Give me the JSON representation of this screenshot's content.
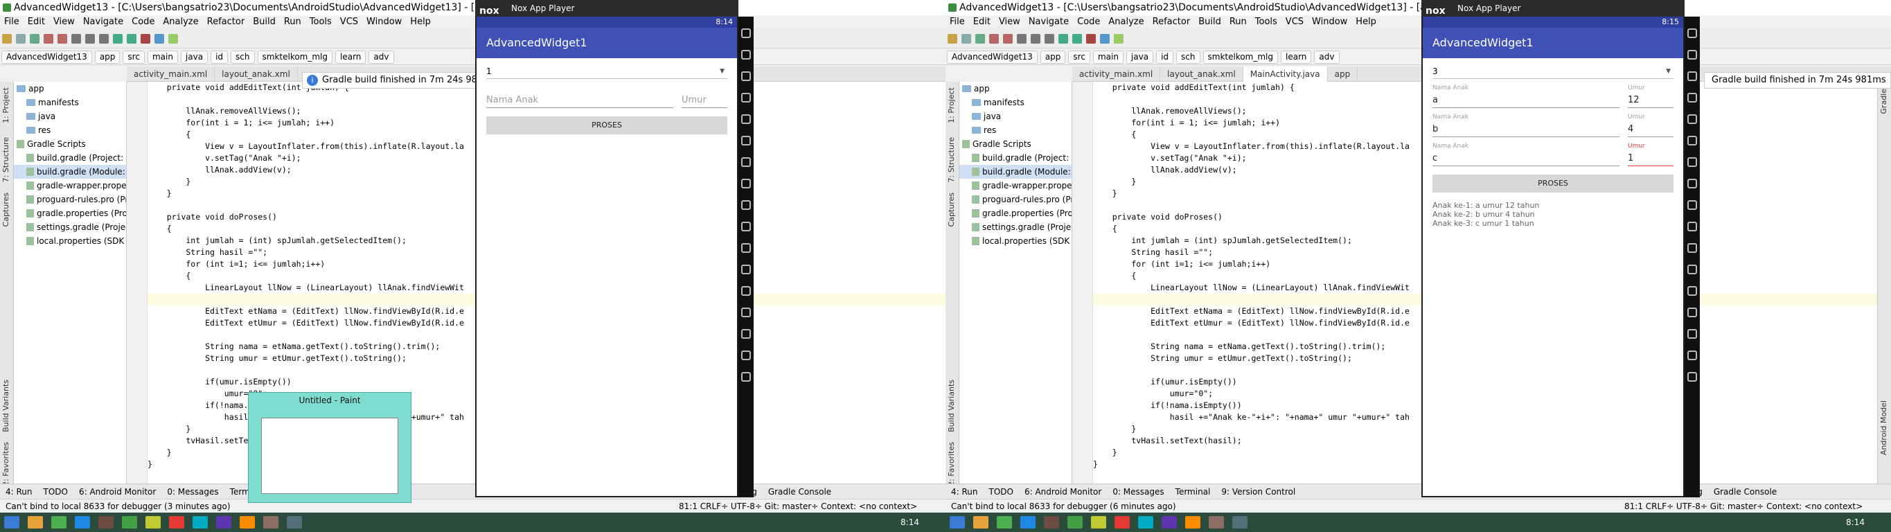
{
  "left": {
    "title": "AdvancedWidget13 - [C:\\Users\\bangsatrio23\\Documents\\AndroidStudio\\AdvancedWidget13] - [ap",
    "menu": [
      "File",
      "Edit",
      "View",
      "Navigate",
      "Code",
      "Analyze",
      "Refactor",
      "Build",
      "Run",
      "Tools",
      "VCS",
      "Window",
      "Help"
    ],
    "breadcrumbs": [
      "AdvancedWidget13",
      "app",
      "src",
      "main",
      "java",
      "id",
      "sch",
      "smktelkom_mlg",
      "learn",
      "adv"
    ],
    "tabs": [
      "activity_main.xml",
      "layout_anak.xml"
    ],
    "toast": "Gradle build finished in 7m 24s 981ms",
    "project_tree": [
      "app",
      "manifests",
      "java",
      "res",
      "Gradle Scripts",
      "build.gradle (Project: Ad",
      "build.gradle (Module: ap",
      "gradle-wrapper.properti",
      "proguard-rules.pro (Prot",
      "gradle.properties (Projec",
      "settings.gradle (Project S",
      "local.properties (SDK Loc"
    ],
    "code": [
      "    private void addEditText(int jumlah) {",
      "",
      "        llAnak.removeAllViews();",
      "        for(int i = 1; i<= jumlah; i++)",
      "        {",
      "            View v = LayoutInflater.from(this).inflate(R.layout.la",
      "            v.setTag(\"Anak \"+i);",
      "            llAnak.addView(v);",
      "        }",
      "    }",
      "",
      "    private void doProses()",
      "    {",
      "        int jumlah = (int) spJumlah.getSelectedItem();",
      "        String hasil =\"\";",
      "        for (int i=1; i<= jumlah;i++)",
      "        {",
      "            LinearLayout llNow = (LinearLayout) llAnak.findViewWit",
      "",
      "            EditText etNama = (EditText) llNow.findViewById(R.id.e",
      "            EditText etUmur = (EditText) llNow.findViewById(R.id.e",
      "",
      "            String nama = etNama.getText().toString().trim();",
      "            String umur = etUmur.getText().toString();",
      "",
      "            if(umur.isEmpty())",
      "                umur=\"0\";",
      "            if(!nama.isEmpty())",
      "                hasil +=\"Anak ke-\"+i+\": \"+nama+\" umur \"+umur+\" tah",
      "        }",
      "        tvHasil.setText(hasil);",
      "    }",
      "}"
    ],
    "bottom_tools": [
      "4: Run",
      "TODO",
      "6: Android Monitor",
      "0: Messages",
      "Terminal",
      "9: Version Control",
      "Event Log",
      "Gradle Console"
    ],
    "status": "Can't bind to local 8633 for debugger (3 minutes ago)",
    "status_right": "81:1   CRLF÷   UTF-8÷   Git: master÷   Context: <no context>",
    "clock": "8:14",
    "paint_title": "Untitled - Paint",
    "nox": {
      "title": "Nox App Player",
      "time": "8:14",
      "app_title": "AdvancedWidget1",
      "spinner": "1",
      "rows": [
        {
          "label_nama": "",
          "nama": "Nama Anak",
          "label_umur": "",
          "umur": "Umur",
          "placeholder": true
        }
      ],
      "button": "PROSES",
      "result": []
    }
  },
  "right": {
    "title": "AdvancedWidget13 - [C:\\Users\\bangsatrio23\\Documents\\AndroidStudio\\AdvancedWidget13] - [ap",
    "tabs": [
      "activity_main.xml",
      "layout_anak.xml",
      "MainActivity.java",
      "app"
    ],
    "toast": "Gradle build finished in 7m 24s 981ms",
    "status": "Can't bind to local 8633 for debugger (6 minutes ago)",
    "clock": "8:14",
    "nox": {
      "title": "Nox App Player",
      "time": "8:15",
      "app_title": "AdvancedWidget1",
      "spinner": "3",
      "rows": [
        {
          "label_nama": "Nama Anak",
          "nama": "a",
          "label_umur": "Umur",
          "umur": "12"
        },
        {
          "label_nama": "Nama Anak",
          "nama": "b",
          "label_umur": "Umur",
          "umur": "4"
        },
        {
          "label_nama": "Nama Anak",
          "nama": "c",
          "label_umur": "Umur",
          "umur": "1"
        }
      ],
      "button": "PROSES",
      "result": [
        "Anak ke-1: a umur 12 tahun",
        "Anak ke-2: b umur 4 tahun",
        "Anak ke-3: c umur 1 tahun"
      ]
    }
  },
  "colors": {
    "appbar": "#3f51b5",
    "statusbar": "#303f9f",
    "taskbar": "#2b4c3c",
    "paint": "#7fdcd0"
  }
}
